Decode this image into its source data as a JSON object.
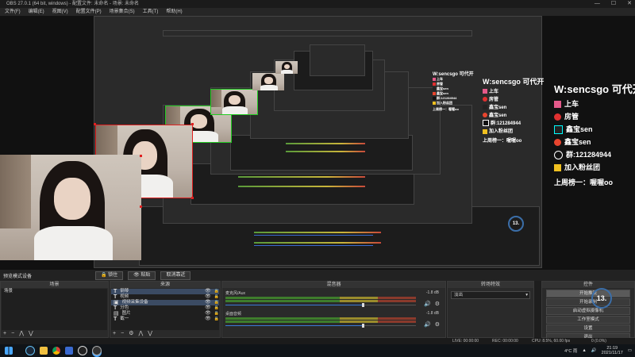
{
  "window": {
    "title": "OBS 27.0.1 (64 bit, windows) - 配置文件: 未命名 - 场景: 未命名",
    "controls": [
      "—",
      "☐",
      "✕"
    ]
  },
  "menu": [
    "文件(F)",
    "编辑(E)",
    "视图(V)",
    "配置文件(P)",
    "场景集合(S)",
    "工具(T)",
    "帮助(H)"
  ],
  "overlay": {
    "title": "W:sencsgo 可代开",
    "lines": [
      {
        "icon": "bilibili-icon",
        "text": "上车"
      },
      {
        "icon": "heart-icon",
        "text": "房管"
      },
      {
        "icon": "tiktok-icon",
        "text": "鑫宝sen"
      },
      {
        "icon": "weibo-icon",
        "text": "鑫宝sen"
      },
      {
        "icon": "penguin-icon",
        "text": "群:121284944"
      },
      {
        "icon": "fan-badge-icon",
        "text": "加入粉丝团"
      }
    ],
    "ranking": "上周榜一：喔喔oo"
  },
  "status_row": {
    "label": "预览模式设备",
    "lock_label": "🔒 锁住",
    "open_label": "👁 粘贴",
    "exit_label": "取消靠近"
  },
  "docks": {
    "scenes": {
      "title": "场景",
      "items": [
        "场景"
      ]
    },
    "sources": {
      "title": "来源",
      "items": [
        {
          "label": "钢琴",
          "selected": true
        },
        {
          "label": "视频",
          "selected": false
        },
        {
          "label": "视频采集设备",
          "selected": true
        },
        {
          "label": "分色",
          "selected": false
        },
        {
          "label": "图片",
          "selected": false
        },
        {
          "label": "截一",
          "selected": false
        }
      ]
    },
    "mixer": {
      "title": "混音器",
      "channels": [
        {
          "name": "麦克风/Aux",
          "db": "-1.8 dB",
          "level": 0.72
        },
        {
          "name": "桌面音频",
          "db": "-1.8 dB",
          "level": 0.72
        }
      ]
    },
    "transitions": {
      "title": "转场特效",
      "value": "淡出"
    },
    "controls": {
      "title": "控件",
      "buttons": [
        {
          "label": "开始推流",
          "active": true
        },
        {
          "label": "开始录制",
          "active": false
        },
        {
          "label": "启动虚拟摄像机",
          "active": false
        },
        {
          "label": "工作室模式",
          "active": false
        },
        {
          "label": "设置",
          "active": false
        },
        {
          "label": "退出",
          "active": false
        }
      ]
    }
  },
  "statusline": {
    "live": "LIVE: 00:00:00",
    "rec": "REC: 00:00:00",
    "cpu": "CPU: 8.5%, 60.00 fps",
    "dropped": "0 (0.0%)"
  },
  "stats_badge": "13.",
  "taskbar": {
    "weather": "4°C 雨",
    "time": "21:19",
    "date": "2021/11/17"
  },
  "colors": {
    "selection_red": "#e02020",
    "selection_green": "#22cc22",
    "accent_blue": "#3b6ea8"
  }
}
